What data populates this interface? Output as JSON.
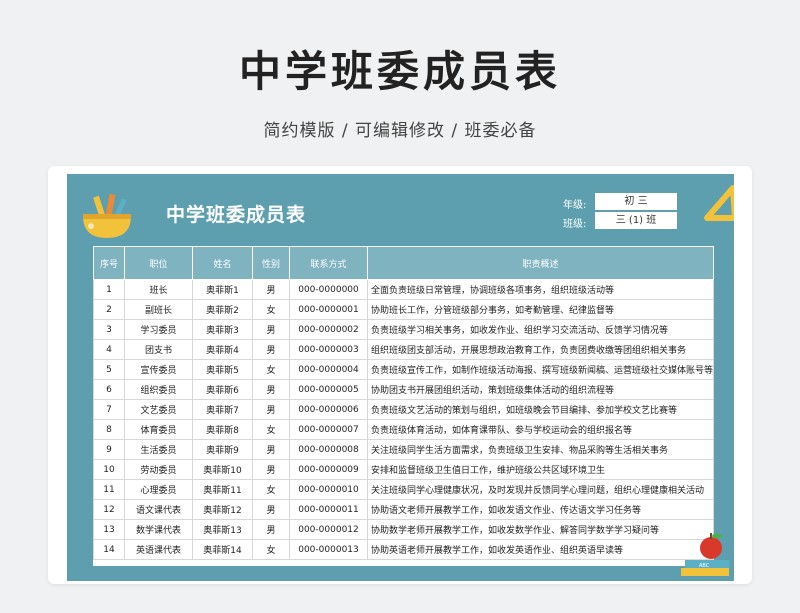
{
  "hero": {
    "title": "中学班委成员表",
    "subtitle": "简约模版 /  可编辑修改  / 班委必备"
  },
  "sheet": {
    "title": "中学班委成员表",
    "grade_label": "年级:",
    "grade_value": "初 三",
    "class_label": "班级:",
    "class_value": "三 (1) 班"
  },
  "table": {
    "headers": [
      "序号",
      "职位",
      "姓名",
      "性别",
      "联系方式",
      "职责概述"
    ],
    "rows": [
      [
        "1",
        "班长",
        "奥菲斯1",
        "男",
        "000-0000000",
        "全面负责班级日常管理，协调班级各项事务，组织班级活动等"
      ],
      [
        "2",
        "副班长",
        "奥菲斯2",
        "女",
        "000-0000001",
        "协助班长工作，分管班级部分事务，如考勤管理、纪律监督等"
      ],
      [
        "3",
        "学习委员",
        "奥菲斯3",
        "男",
        "000-0000002",
        "负责班级学习相关事务，如收发作业、组织学习交流活动、反馈学习情况等"
      ],
      [
        "4",
        "团支书",
        "奥菲斯4",
        "男",
        "000-0000003",
        "组织班级团支部活动，开展思想政治教育工作，负责团费收缴等团组织相关事务"
      ],
      [
        "5",
        "宣传委员",
        "奥菲斯5",
        "女",
        "000-0000004",
        "负责班级宣传工作，如制作班级活动海报、撰写班级新闻稿、运营班级社交媒体账号等"
      ],
      [
        "6",
        "组织委员",
        "奥菲斯6",
        "男",
        "000-0000005",
        "协助团支书开展团组织活动，策划班级集体活动的组织流程等"
      ],
      [
        "7",
        "文艺委员",
        "奥菲斯7",
        "男",
        "000-0000006",
        "负责班级文艺活动的策划与组织，如班级晚会节目编排、参加学校文艺比赛等"
      ],
      [
        "8",
        "体育委员",
        "奥菲斯8",
        "女",
        "000-0000007",
        "负责班级体育活动，如体育课带队、参与学校运动会的组织报名等"
      ],
      [
        "9",
        "生活委员",
        "奥菲斯9",
        "男",
        "000-0000008",
        "关注班级同学生活方面需求，负责班级卫生安排、物品采购等生活相关事务"
      ],
      [
        "10",
        "劳动委员",
        "奥菲斯10",
        "男",
        "000-0000009",
        "安排和监督班级卫生值日工作，维护班级公共区域环境卫生"
      ],
      [
        "11",
        "心理委员",
        "奥菲斯11",
        "女",
        "000-0000010",
        "关注班级同学心理健康状况，及时发现并反馈同学心理问题，组织心理健康相关活动"
      ],
      [
        "12",
        "语文课代表",
        "奥菲斯12",
        "男",
        "000-0000011",
        "协助语文老师开展教学工作，如收发语文作业、传达语文学习任务等"
      ],
      [
        "13",
        "数学课代表",
        "奥菲斯13",
        "男",
        "000-0000012",
        "协助数学老师开展教学工作，如收发数学作业、解答同学数学学习疑问等"
      ],
      [
        "14",
        "英语课代表",
        "奥菲斯14",
        "女",
        "000-0000013",
        "协助英语老师开展教学工作，如收发英语作业、组织英语早读等"
      ]
    ]
  },
  "decor": {
    "books_label": "ABC",
    "accent_teal": "#5d9fae",
    "header_teal": "#7fb3c0",
    "pencil_yellow": "#f2c23a",
    "apple_red": "#d9392b"
  }
}
